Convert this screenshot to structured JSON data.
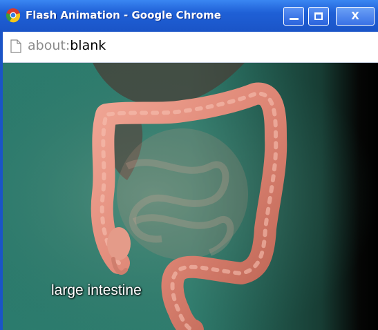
{
  "window": {
    "title": "Flash Animation - Google Chrome",
    "controls": {
      "minimize": "minimize",
      "maximize": "maximize",
      "close_label": "X"
    }
  },
  "address_bar": {
    "scheme": "about:",
    "path": "blank"
  },
  "video": {
    "caption": "large intestine"
  },
  "colors": {
    "titlebar": "#1f60d6",
    "background_tissue": "#2f7f70",
    "intestine": "#e08c7a"
  }
}
